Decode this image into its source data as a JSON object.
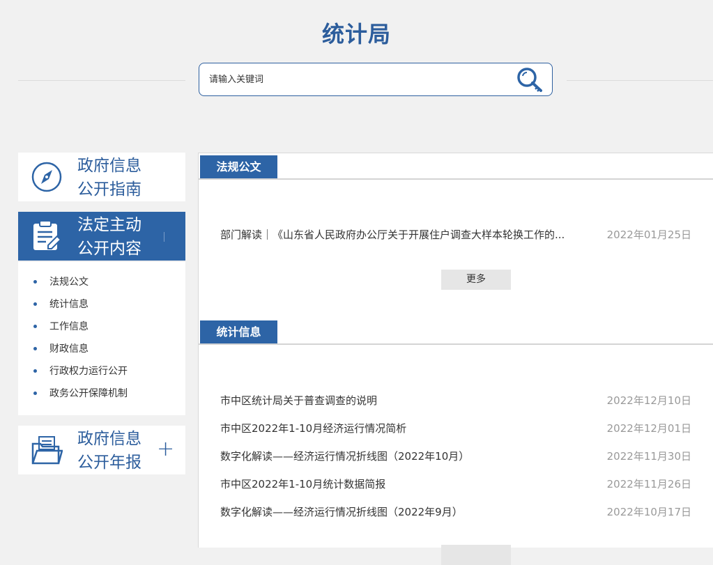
{
  "header": {
    "title": "统计局"
  },
  "search": {
    "placeholder": "请输入关键词",
    "icon": "search-key-icon"
  },
  "sidebar": {
    "guide": {
      "title_line1": "政府信息",
      "title_line2": "公开指南",
      "icon": "compass-icon"
    },
    "content": {
      "title_line1": "法定主动",
      "title_line2": "公开内容",
      "icon": "clipboard-edit-icon",
      "items": [
        {
          "label": "法规公文"
        },
        {
          "label": "统计信息"
        },
        {
          "label": "工作信息"
        },
        {
          "label": "财政信息"
        },
        {
          "label": "行政权力运行公开"
        },
        {
          "label": "政务公开保障机制"
        }
      ]
    },
    "annual": {
      "title_line1": "政府信息",
      "title_line2": "公开年报",
      "icon": "folder-document-icon",
      "expand": "+"
    }
  },
  "colors": {
    "primary": "#2d64a6",
    "title": "#2c5d9c",
    "date": "#999999",
    "background": "#f1f1f1"
  },
  "sections": [
    {
      "title": "法规公文",
      "items": [
        {
          "title": "部门解读｜《山东省人民政府办公厅关于开展住户调查大样本轮换工作的...",
          "date": "2022年01月25日"
        }
      ],
      "more": "更多"
    },
    {
      "title": "统计信息",
      "items": [
        {
          "title": "市中区统计局关于普查调查的说明",
          "date": "2022年12月10日"
        },
        {
          "title": "市中区2022年1-10月经济运行情况简析",
          "date": "2022年12月01日"
        },
        {
          "title": "数字化解读——经济运行情况折线图（2022年10月）",
          "date": "2022年11月30日"
        },
        {
          "title": "市中区2022年1-10月统计数据简报",
          "date": "2022年11月26日"
        },
        {
          "title": "数字化解读——经济运行情况折线图（2022年9月）",
          "date": "2022年10月17日"
        }
      ]
    }
  ]
}
